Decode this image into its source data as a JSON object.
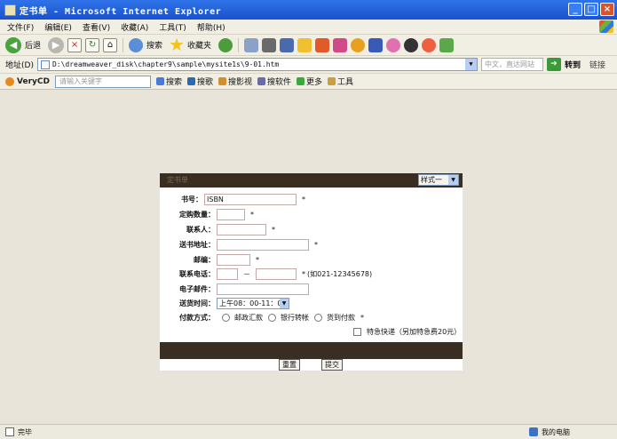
{
  "window": {
    "title": "定书单 - Microsoft Internet Explorer",
    "min": "_",
    "max": "□",
    "close": "×"
  },
  "menu": [
    "文件(F)",
    "编辑(E)",
    "查看(V)",
    "收藏(A)",
    "工具(T)",
    "帮助(H)"
  ],
  "toolbar": {
    "back": "后退",
    "back_arrow": "◀",
    "forward_arrow": "▶",
    "stop": "×",
    "refresh": "↻",
    "home": "⌂",
    "search": "搜索",
    "favorites": "收藏夹"
  },
  "address": {
    "label": "地址(D)",
    "url": "D:\\dreamweaver_disk\\chapter9\\sample\\mysite1s\\9-01.htm",
    "search_placeholder": "中文，直达网站",
    "go": "转到",
    "links": "链接"
  },
  "linksbar": {
    "brand": "VeryCD",
    "search_placeholder": "请输入关键字",
    "items": [
      "搜索",
      "搜歌",
      "搜影视",
      "搜软件",
      "更多",
      "工具"
    ]
  },
  "form": {
    "header_caption": "定书单",
    "style_select": "样式一",
    "isbn_label": "书号：",
    "isbn_value": "ISBN",
    "qty_label": "定购数量：",
    "contact_label": "联系人：",
    "address_label": "送书地址：",
    "zip_label": "邮编：",
    "phone_label": "联系电话：",
    "phone_sep": "－",
    "phone_hint": "(如021-12345678)",
    "email_label": "电子邮件：",
    "time_label": "送货时间：",
    "time_value": "上午08：00-11：00",
    "pay_label": "付款方式：",
    "pay_options": [
      "邮政汇款",
      "银行转帐",
      "货到付款"
    ],
    "express_label": "特急快递（另加特急费20元）",
    "required": "*",
    "reset": "重置",
    "submit": "提交"
  },
  "status": {
    "text": "完毕",
    "zone": "我的电脑"
  }
}
